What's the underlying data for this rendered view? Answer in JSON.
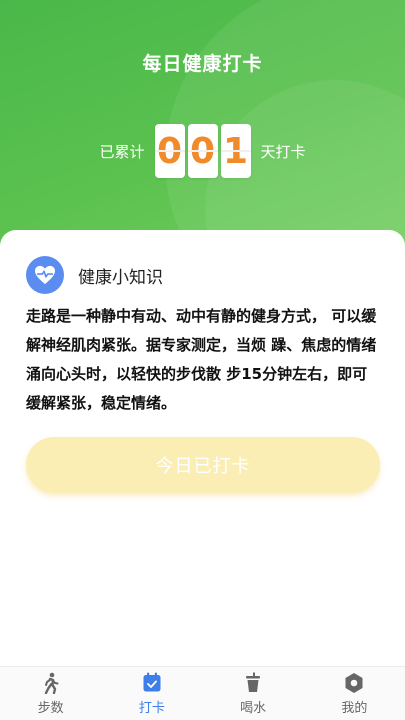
{
  "header": {
    "title": "每日健康打卡",
    "counter_prefix": "已累计",
    "counter_digits": [
      "0",
      "0",
      "1"
    ],
    "counter_suffix": "天打卡"
  },
  "tip": {
    "icon": "heart-pulse-icon",
    "title": "健康小知识",
    "body": "走路是一种静中有动、动中有静的健身方式， 可以缓解神经肌肉紧张。据专家测定，当烦 躁、焦虑的情绪涌向心头时，以轻快的步伐散 步15分钟左右，即可缓解紧张，稳定情绪。"
  },
  "checkin_button": {
    "label": "今日已打卡"
  },
  "tabbar": {
    "tabs": [
      {
        "label": "步数",
        "icon": "walking-icon",
        "active": false
      },
      {
        "label": "打卡",
        "icon": "calendar-check-icon",
        "active": true
      },
      {
        "label": "喝水",
        "icon": "cup-icon",
        "active": false
      },
      {
        "label": "我的",
        "icon": "settings-hexagon-icon",
        "active": false
      }
    ]
  },
  "colors": {
    "header_green": "#55bd4d",
    "digit_orange": "#f08a2a",
    "tip_icon_blue": "#5b8df0",
    "button_yellow": "#fbeeb4",
    "tab_active": "#3d7ee8",
    "tab_inactive": "#666666"
  }
}
